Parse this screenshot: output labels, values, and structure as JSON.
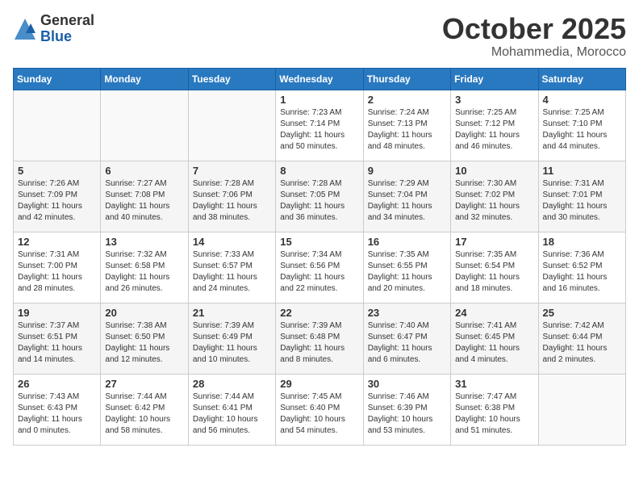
{
  "header": {
    "logo_general": "General",
    "logo_blue": "Blue",
    "month": "October 2025",
    "location": "Mohammedia, Morocco"
  },
  "days_of_week": [
    "Sunday",
    "Monday",
    "Tuesday",
    "Wednesday",
    "Thursday",
    "Friday",
    "Saturday"
  ],
  "weeks": [
    [
      {
        "day": "",
        "info": ""
      },
      {
        "day": "",
        "info": ""
      },
      {
        "day": "",
        "info": ""
      },
      {
        "day": "1",
        "info": "Sunrise: 7:23 AM\nSunset: 7:14 PM\nDaylight: 11 hours\nand 50 minutes."
      },
      {
        "day": "2",
        "info": "Sunrise: 7:24 AM\nSunset: 7:13 PM\nDaylight: 11 hours\nand 48 minutes."
      },
      {
        "day": "3",
        "info": "Sunrise: 7:25 AM\nSunset: 7:12 PM\nDaylight: 11 hours\nand 46 minutes."
      },
      {
        "day": "4",
        "info": "Sunrise: 7:25 AM\nSunset: 7:10 PM\nDaylight: 11 hours\nand 44 minutes."
      }
    ],
    [
      {
        "day": "5",
        "info": "Sunrise: 7:26 AM\nSunset: 7:09 PM\nDaylight: 11 hours\nand 42 minutes."
      },
      {
        "day": "6",
        "info": "Sunrise: 7:27 AM\nSunset: 7:08 PM\nDaylight: 11 hours\nand 40 minutes."
      },
      {
        "day": "7",
        "info": "Sunrise: 7:28 AM\nSunset: 7:06 PM\nDaylight: 11 hours\nand 38 minutes."
      },
      {
        "day": "8",
        "info": "Sunrise: 7:28 AM\nSunset: 7:05 PM\nDaylight: 11 hours\nand 36 minutes."
      },
      {
        "day": "9",
        "info": "Sunrise: 7:29 AM\nSunset: 7:04 PM\nDaylight: 11 hours\nand 34 minutes."
      },
      {
        "day": "10",
        "info": "Sunrise: 7:30 AM\nSunset: 7:02 PM\nDaylight: 11 hours\nand 32 minutes."
      },
      {
        "day": "11",
        "info": "Sunrise: 7:31 AM\nSunset: 7:01 PM\nDaylight: 11 hours\nand 30 minutes."
      }
    ],
    [
      {
        "day": "12",
        "info": "Sunrise: 7:31 AM\nSunset: 7:00 PM\nDaylight: 11 hours\nand 28 minutes."
      },
      {
        "day": "13",
        "info": "Sunrise: 7:32 AM\nSunset: 6:58 PM\nDaylight: 11 hours\nand 26 minutes."
      },
      {
        "day": "14",
        "info": "Sunrise: 7:33 AM\nSunset: 6:57 PM\nDaylight: 11 hours\nand 24 minutes."
      },
      {
        "day": "15",
        "info": "Sunrise: 7:34 AM\nSunset: 6:56 PM\nDaylight: 11 hours\nand 22 minutes."
      },
      {
        "day": "16",
        "info": "Sunrise: 7:35 AM\nSunset: 6:55 PM\nDaylight: 11 hours\nand 20 minutes."
      },
      {
        "day": "17",
        "info": "Sunrise: 7:35 AM\nSunset: 6:54 PM\nDaylight: 11 hours\nand 18 minutes."
      },
      {
        "day": "18",
        "info": "Sunrise: 7:36 AM\nSunset: 6:52 PM\nDaylight: 11 hours\nand 16 minutes."
      }
    ],
    [
      {
        "day": "19",
        "info": "Sunrise: 7:37 AM\nSunset: 6:51 PM\nDaylight: 11 hours\nand 14 minutes."
      },
      {
        "day": "20",
        "info": "Sunrise: 7:38 AM\nSunset: 6:50 PM\nDaylight: 11 hours\nand 12 minutes."
      },
      {
        "day": "21",
        "info": "Sunrise: 7:39 AM\nSunset: 6:49 PM\nDaylight: 11 hours\nand 10 minutes."
      },
      {
        "day": "22",
        "info": "Sunrise: 7:39 AM\nSunset: 6:48 PM\nDaylight: 11 hours\nand 8 minutes."
      },
      {
        "day": "23",
        "info": "Sunrise: 7:40 AM\nSunset: 6:47 PM\nDaylight: 11 hours\nand 6 minutes."
      },
      {
        "day": "24",
        "info": "Sunrise: 7:41 AM\nSunset: 6:45 PM\nDaylight: 11 hours\nand 4 minutes."
      },
      {
        "day": "25",
        "info": "Sunrise: 7:42 AM\nSunset: 6:44 PM\nDaylight: 11 hours\nand 2 minutes."
      }
    ],
    [
      {
        "day": "26",
        "info": "Sunrise: 7:43 AM\nSunset: 6:43 PM\nDaylight: 11 hours\nand 0 minutes."
      },
      {
        "day": "27",
        "info": "Sunrise: 7:44 AM\nSunset: 6:42 PM\nDaylight: 10 hours\nand 58 minutes."
      },
      {
        "day": "28",
        "info": "Sunrise: 7:44 AM\nSunset: 6:41 PM\nDaylight: 10 hours\nand 56 minutes."
      },
      {
        "day": "29",
        "info": "Sunrise: 7:45 AM\nSunset: 6:40 PM\nDaylight: 10 hours\nand 54 minutes."
      },
      {
        "day": "30",
        "info": "Sunrise: 7:46 AM\nSunset: 6:39 PM\nDaylight: 10 hours\nand 53 minutes."
      },
      {
        "day": "31",
        "info": "Sunrise: 7:47 AM\nSunset: 6:38 PM\nDaylight: 10 hours\nand 51 minutes."
      },
      {
        "day": "",
        "info": ""
      }
    ]
  ]
}
